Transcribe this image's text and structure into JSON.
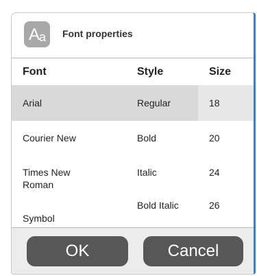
{
  "dialog": {
    "title": "Font properties",
    "icon": {
      "name": "font-icon",
      "glyph_big": "A",
      "glyph_small": "a"
    }
  },
  "table": {
    "headers": {
      "font": "Font",
      "style": "Style",
      "size": "Size"
    },
    "rows": [
      {
        "font": "Arial",
        "style": "Regular",
        "size": "18",
        "selected": true
      },
      {
        "font": "Courier New",
        "style": "Bold",
        "size": "20",
        "selected": false
      },
      {
        "font": "Times New Roman",
        "style": "Italic",
        "size": "24",
        "selected": false
      },
      {
        "font": "Symbol",
        "style": "Bold Italic",
        "size": "26",
        "selected": false
      }
    ]
  },
  "buttons": {
    "ok": "OK",
    "cancel": "Cancel"
  },
  "colors": {
    "accent_border": "#3e7dc3",
    "selected_row": "#d9d9d9",
    "button_bg": "#575757",
    "footer_bg": "#ececec"
  }
}
